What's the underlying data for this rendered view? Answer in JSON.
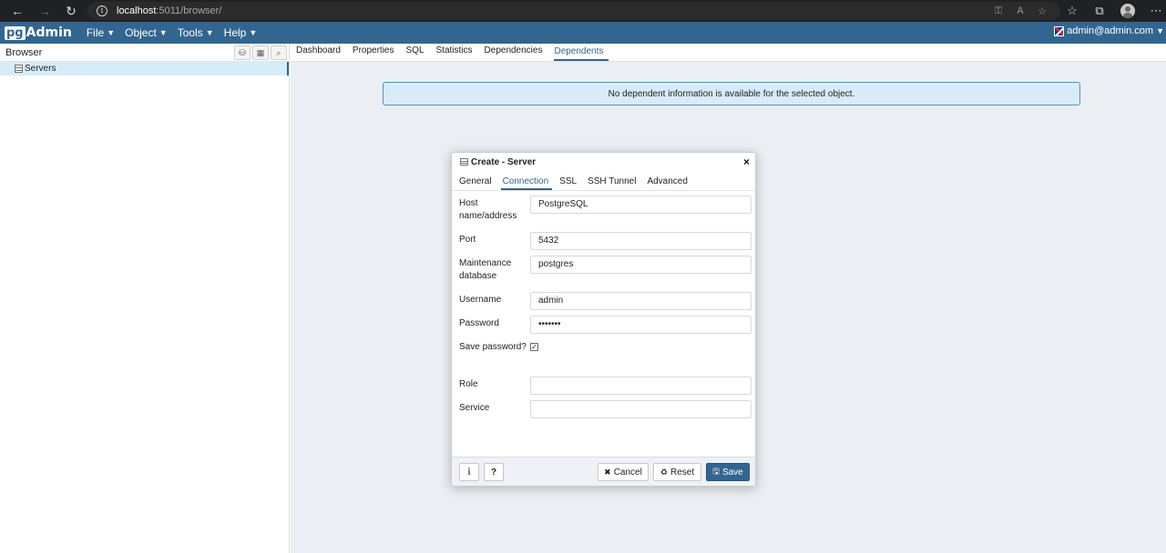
{
  "browser": {
    "url_host": "localhost",
    "url_path": ":5011/browser/",
    "back_icon": "arrow-left-icon",
    "forward_icon": "arrow-right-icon",
    "reload_icon": "reload-icon"
  },
  "app": {
    "logo_pg": "pg",
    "logo_admin": "Admin",
    "menus": [
      {
        "label": "File"
      },
      {
        "label": "Object"
      },
      {
        "label": "Tools"
      },
      {
        "label": "Help"
      }
    ],
    "user": "admin@admin.com"
  },
  "left_panel": {
    "title": "Browser",
    "tree": [
      {
        "label": "Servers"
      }
    ]
  },
  "right_panel": {
    "tabs": [
      {
        "label": "Dashboard"
      },
      {
        "label": "Properties"
      },
      {
        "label": "SQL"
      },
      {
        "label": "Statistics"
      },
      {
        "label": "Dependencies"
      },
      {
        "label": "Dependents",
        "active": true
      }
    ],
    "alert": "No dependent information is available for the selected object."
  },
  "dialog": {
    "title": "Create - Server",
    "close": "×",
    "tabs": [
      {
        "label": "General"
      },
      {
        "label": "Connection",
        "active": true
      },
      {
        "label": "SSL"
      },
      {
        "label": "SSH Tunnel"
      },
      {
        "label": "Advanced"
      }
    ],
    "fields": {
      "host": {
        "label": "Host name/address",
        "value": "PostgreSQL"
      },
      "port": {
        "label": "Port",
        "value": "5432"
      },
      "maintenance_db": {
        "label": "Maintenance database",
        "value": "postgres"
      },
      "username": {
        "label": "Username",
        "value": "admin"
      },
      "password": {
        "label": "Password",
        "value": "•••••••"
      },
      "save_password": {
        "label": "Save password?",
        "checked": "✓"
      },
      "role": {
        "label": "Role",
        "value": ""
      },
      "service": {
        "label": "Service",
        "value": ""
      }
    },
    "footer": {
      "info": "i",
      "help": "?",
      "cancel": "Cancel",
      "reset": "Reset",
      "save": "Save"
    }
  },
  "colors": {
    "brand": "#326690",
    "alert_bg": "#d7ecf8",
    "selected_row": "#d6ecf7"
  }
}
